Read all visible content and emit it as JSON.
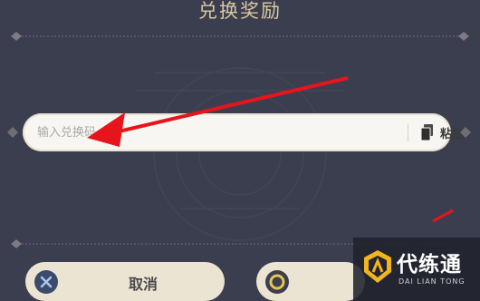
{
  "dialog": {
    "title": "兑换奖励"
  },
  "code_field": {
    "value": "",
    "placeholder": "输入兑换码",
    "paste_label": "粘贴"
  },
  "buttons": {
    "cancel_label": "取消",
    "confirm_label": ""
  },
  "watermark": {
    "title": "代练通",
    "subtitle": "DAI LIAN TONG"
  },
  "icons": {
    "paste": "clipboard-icon",
    "cancel": "close-x-icon",
    "confirm": "confirm-circle-icon",
    "annotation": "red-arrow"
  },
  "colors": {
    "background": "#3b3e4f",
    "title_gold": "#d9c7a0",
    "input_bg": "#f7f6f2",
    "button_bg": "#ece4d2",
    "annotation_red": "#e8141b"
  }
}
